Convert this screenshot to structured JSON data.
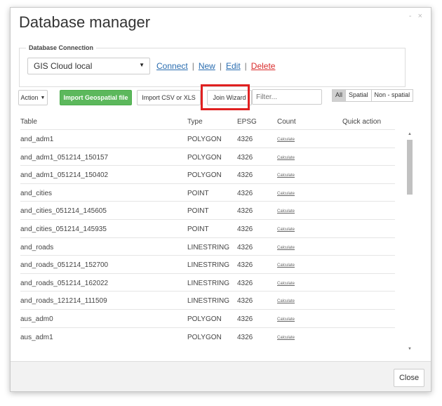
{
  "dialog": {
    "title": "Database manager",
    "controls": {
      "minimize": "-",
      "close": "×"
    }
  },
  "connection": {
    "legend": "Database Connection",
    "selected_db": "GIS Cloud local",
    "links": {
      "connect": "Connect",
      "new": "New",
      "edit": "Edit",
      "delete": "Delete"
    },
    "separator": "|"
  },
  "toolbar": {
    "action_label": "Action",
    "import_geo_label": "Import Geospatial file",
    "import_csv_label": "Import CSV or XLS",
    "join_wizard_label": "Join Wizard",
    "filter_placeholder": "Filter...",
    "segments": {
      "all": "All",
      "spatial": "Spatial",
      "non_spatial": "Non - spatial"
    },
    "active_segment": "All"
  },
  "table": {
    "headers": {
      "table": "Table",
      "type": "Type",
      "epsg": "EPSG",
      "count": "Count",
      "quick": "Quick action"
    },
    "calc_label": "Calculate",
    "rows": [
      {
        "name": "and_adm1",
        "type": "POLYGON",
        "epsg": "4326"
      },
      {
        "name": "and_adm1_051214_150157",
        "type": "POLYGON",
        "epsg": "4326"
      },
      {
        "name": "and_adm1_051214_150402",
        "type": "POLYGON",
        "epsg": "4326"
      },
      {
        "name": "and_cities",
        "type": "POINT",
        "epsg": "4326"
      },
      {
        "name": "and_cities_051214_145605",
        "type": "POINT",
        "epsg": "4326"
      },
      {
        "name": "and_cities_051214_145935",
        "type": "POINT",
        "epsg": "4326"
      },
      {
        "name": "and_roads",
        "type": "LINESTRING",
        "epsg": "4326"
      },
      {
        "name": "and_roads_051214_152700",
        "type": "LINESTRING",
        "epsg": "4326"
      },
      {
        "name": "and_roads_051214_162022",
        "type": "LINESTRING",
        "epsg": "4326"
      },
      {
        "name": "and_roads_121214_111509",
        "type": "LINESTRING",
        "epsg": "4326"
      },
      {
        "name": "aus_adm0",
        "type": "POLYGON",
        "epsg": "4326"
      },
      {
        "name": "aus_adm1",
        "type": "POLYGON",
        "epsg": "4326"
      }
    ]
  },
  "footer": {
    "close_label": "Close"
  },
  "colors": {
    "accent_green": "#5cb85c",
    "link_blue": "#2a6db0",
    "delete_red": "#d92b2b",
    "highlight_red": "#e02020"
  }
}
